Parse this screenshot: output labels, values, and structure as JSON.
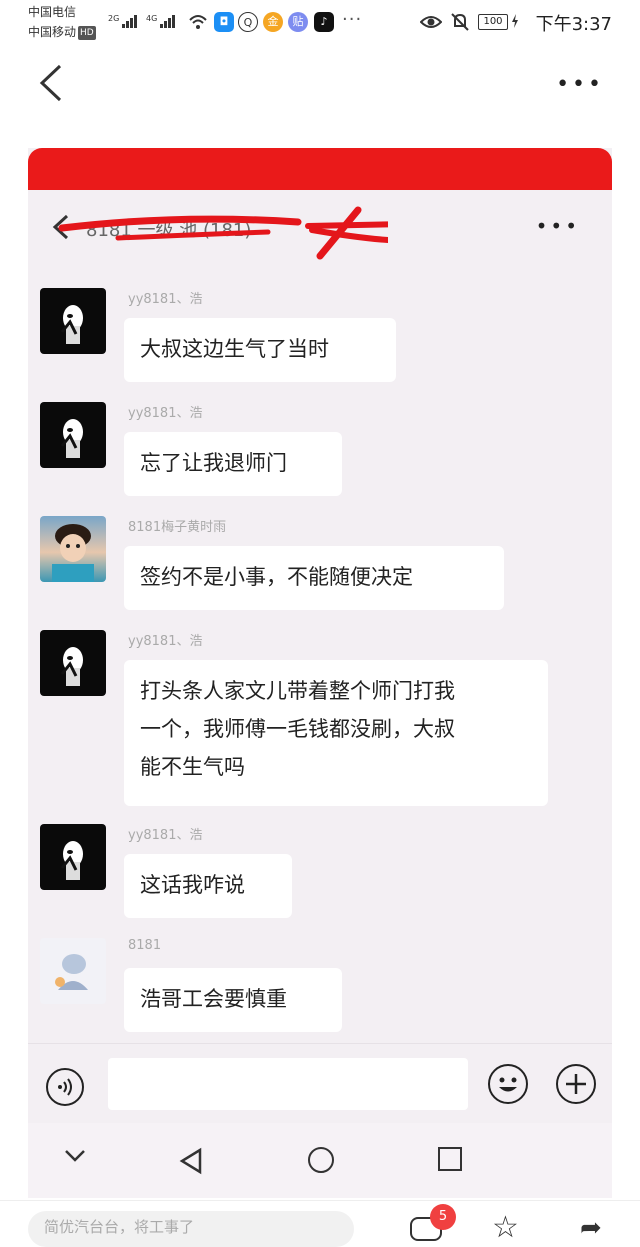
{
  "status_bar": {
    "carrier_1": "中国电信",
    "carrier_2": "中国移动",
    "hd_badge": "HD",
    "net_1": "2G",
    "net_2": "4G",
    "ellipsis": "···",
    "battery": "100",
    "time": "下午3:37"
  },
  "messages": [
    {
      "sender": "yy8181、浩",
      "lines": [
        "大叔这边生气了当时"
      ]
    },
    {
      "sender": "yy8181、浩",
      "lines": [
        "忘了让我退师门"
      ]
    },
    {
      "sender": "8181梅子黄时雨",
      "lines": [
        "签约不是小事，不能随便决定"
      ]
    },
    {
      "sender": "yy8181、浩",
      "lines": [
        "打头条人家文儿带着整个师门打我",
        "一个，我师傅一毛钱都没刷，大叔",
        "能不生气吗"
      ]
    },
    {
      "sender": "yy8181、浩",
      "lines": [
        "这话我咋说"
      ]
    },
    {
      "sender": "8181",
      "lines": [
        "浩哥工会要慎重"
      ]
    }
  ],
  "bottom_bar": {
    "comment_placeholder": "简优汽台台，将工事了",
    "comment_count": "5"
  },
  "icons": {
    "outer_back": "back-chevron-icon",
    "outer_more": "more-icon",
    "inner_back": "back-chevron-icon",
    "inner_more": "more-icon",
    "voice": "voice-icon",
    "emoji": "emoji-icon",
    "plus": "plus-icon",
    "nav_hide": "chevron-down-icon",
    "nav_back": "triangle-back-icon",
    "nav_home": "circle-home-icon",
    "nav_recent": "square-recent-icon",
    "comment": "comment-icon",
    "star": "star-icon",
    "share": "share-icon"
  },
  "colors": {
    "redaction": "#ea1a1a",
    "chat_bg": "#f3eff3",
    "bubble": "#ffffff",
    "badge": "#f04040"
  }
}
